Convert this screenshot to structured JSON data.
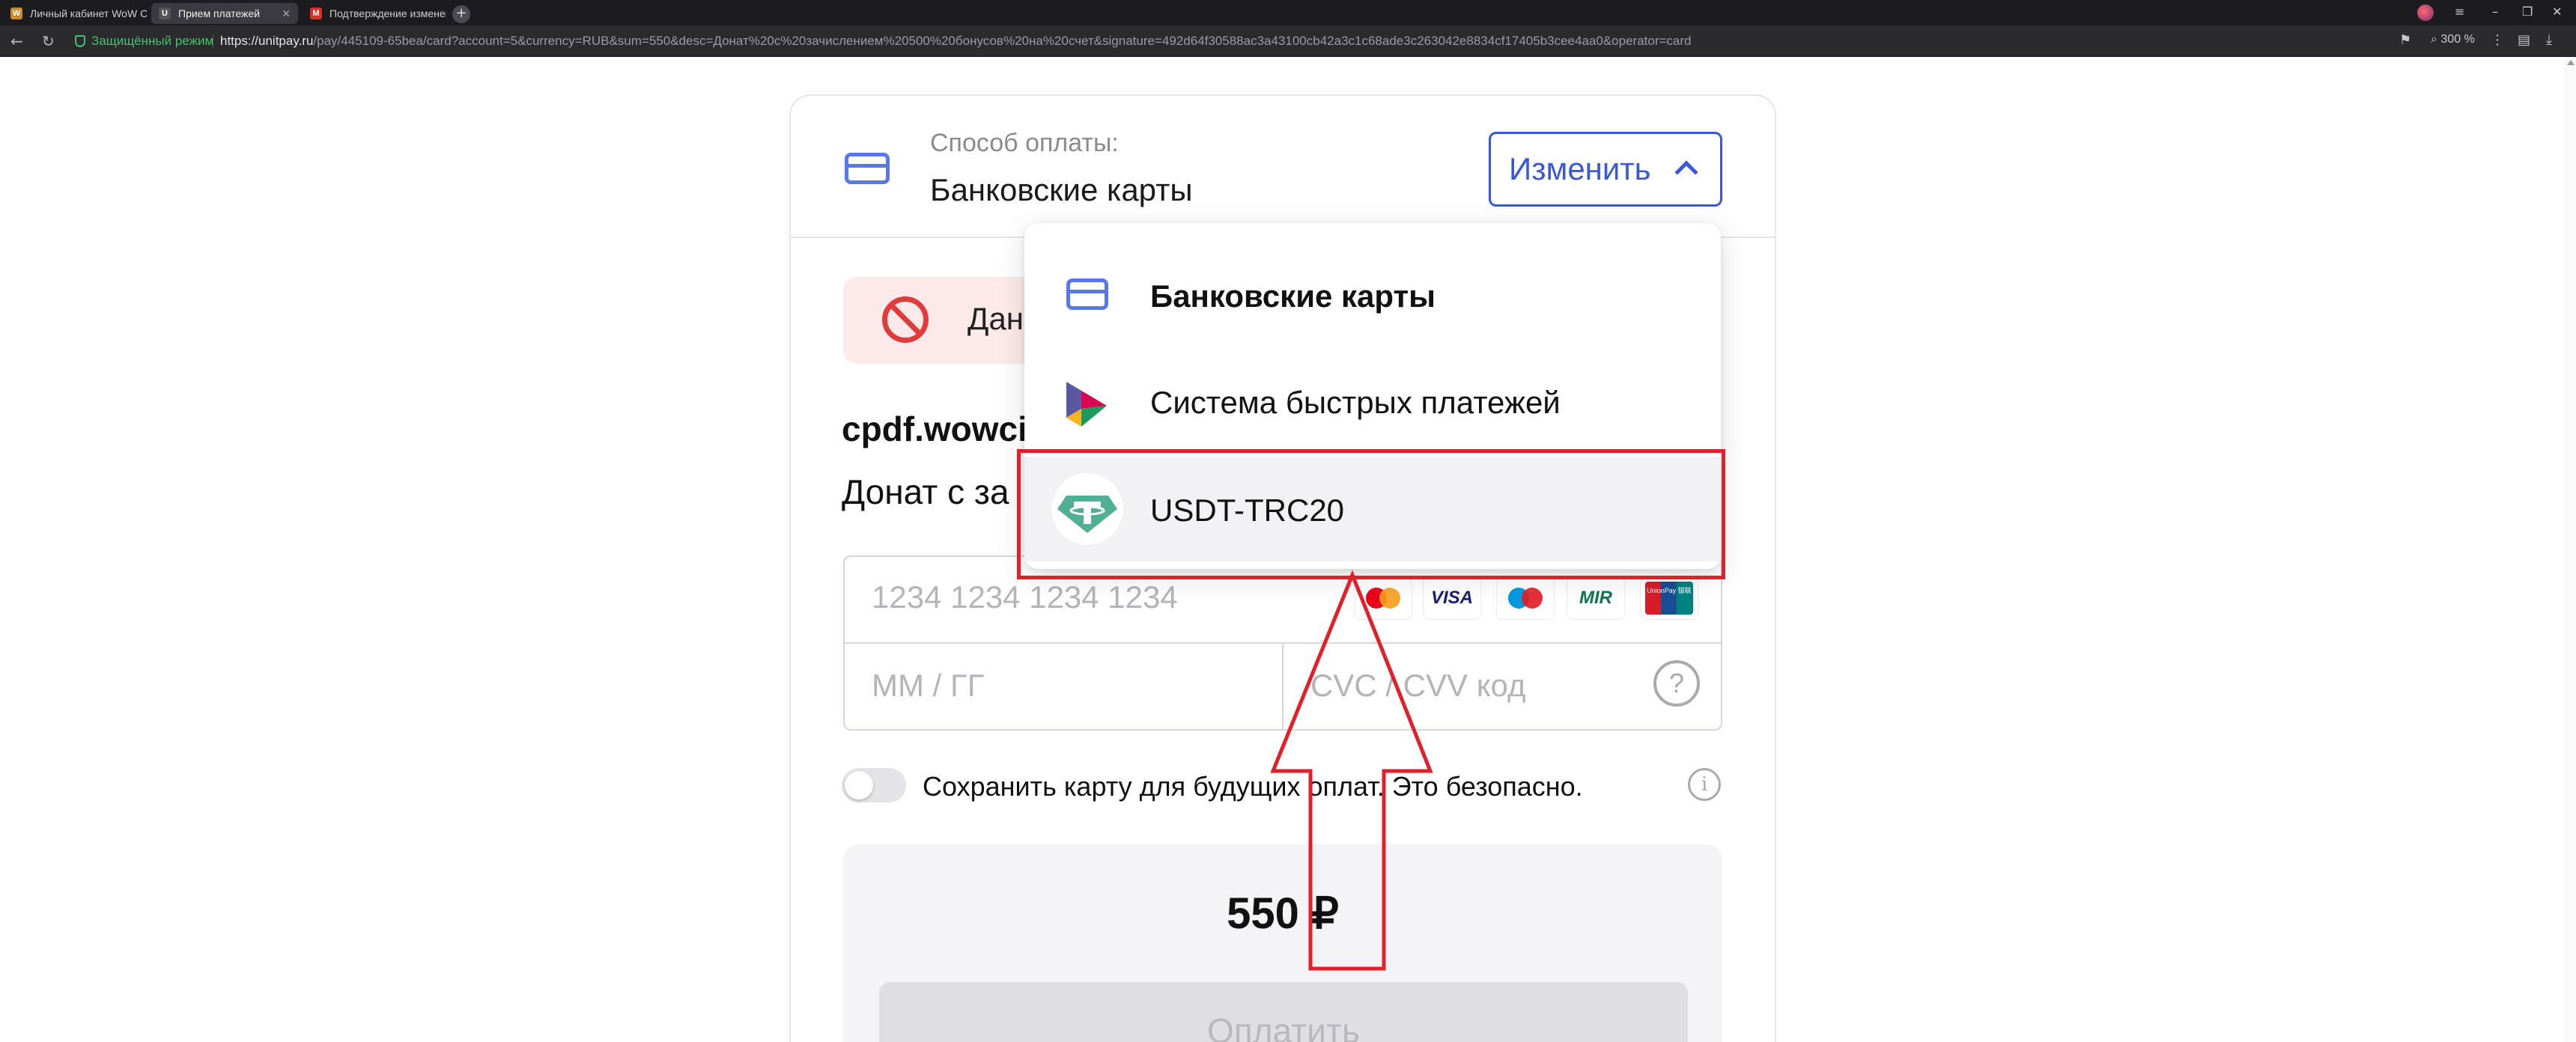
{
  "browser": {
    "tabs": [
      {
        "title": "Личный кабинет WoW Ci",
        "favicon": "W",
        "active": false
      },
      {
        "title": "Прием платежей",
        "favicon": "U",
        "active": true
      },
      {
        "title": "Подтверждение изменен",
        "favicon": "M",
        "active": false
      }
    ],
    "secure_label": "Защищённый режим",
    "url_host": "https://unitpay.ru",
    "url_path": "/pay/445109-65bea/card?account=5&currency=RUB&sum=550&desc=Донат%20с%20зачислением%20500%20бонусов%20на%20счет&signature=492d64f30588ac3a43100cb42a3c1c68ade3c263042e8834cf17405b3cee4aa0&operator=card",
    "zoom": "300 %"
  },
  "payment": {
    "method_label": "Способ оплаты:",
    "method_value": "Банковские карты",
    "change_button": "Изменить",
    "alert_text": "Дан",
    "merchant": "cpdf.wowci",
    "description": "Донат с за",
    "card_number_placeholder": "1234 1234 1234 1234",
    "expiry_placeholder": "ММ / ГГ",
    "cvc_placeholder": "CVC / CVV код",
    "help_glyph": "?",
    "save_card_text": "Сохранить карту для будущих оплат. Это безопасно.",
    "info_glyph": "i",
    "amount": "550 ₽",
    "pay_button": "Оплатить"
  },
  "brands": [
    {
      "name": "mastercard",
      "label": ""
    },
    {
      "name": "visa",
      "label": "VISA"
    },
    {
      "name": "maestro",
      "label": ""
    },
    {
      "name": "mir",
      "label": "MIR"
    },
    {
      "name": "unionpay",
      "label": "UnionPay 银联"
    }
  ],
  "dropdown": {
    "items": [
      {
        "label": "Банковские карты",
        "icon": "card-icon"
      },
      {
        "label": "Система быстрых платежей",
        "icon": "sbp-icon"
      },
      {
        "label": "USDT-TRC20",
        "icon": "tether-icon"
      }
    ]
  },
  "colors": {
    "accent": "#3a57d6",
    "card_icon": "#5877e8",
    "error": "#e23b3b",
    "annotation": "#e0202a",
    "tether": "#50af95"
  }
}
